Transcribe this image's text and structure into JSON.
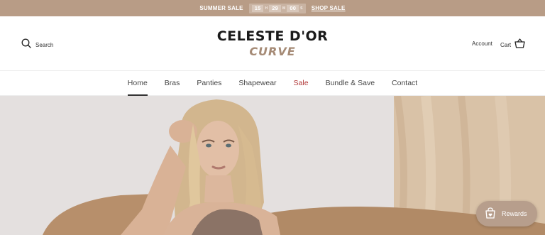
{
  "announcement": {
    "label": "SUMMER SALE",
    "timer": {
      "hours": "15",
      "minutes": "29",
      "seconds": "00"
    },
    "timer_units": {
      "h": "H",
      "m": "M",
      "s": "S"
    },
    "link": "SHOP SALE"
  },
  "header": {
    "search_label": "Search",
    "logo_main": "CELESTE D'OR",
    "logo_sub": "CURVE",
    "account_label": "Account",
    "cart_label": "Cart"
  },
  "nav": {
    "items": [
      {
        "label": "Home"
      },
      {
        "label": "Bras"
      },
      {
        "label": "Panties"
      },
      {
        "label": "Shapewear"
      },
      {
        "label": "Sale"
      },
      {
        "label": "Bundle & Save"
      },
      {
        "label": "Contact"
      }
    ],
    "active": "Home"
  },
  "rewards": {
    "label": "Rewards"
  },
  "colors": {
    "announcement_bg": "#b89c86",
    "sale_nav": "#b23a3a",
    "logo_accent": "#a58a75",
    "rewards_bg": "#b79e8c"
  },
  "icons": [
    "search-icon",
    "cart-icon",
    "rewards-bag-icon"
  ]
}
